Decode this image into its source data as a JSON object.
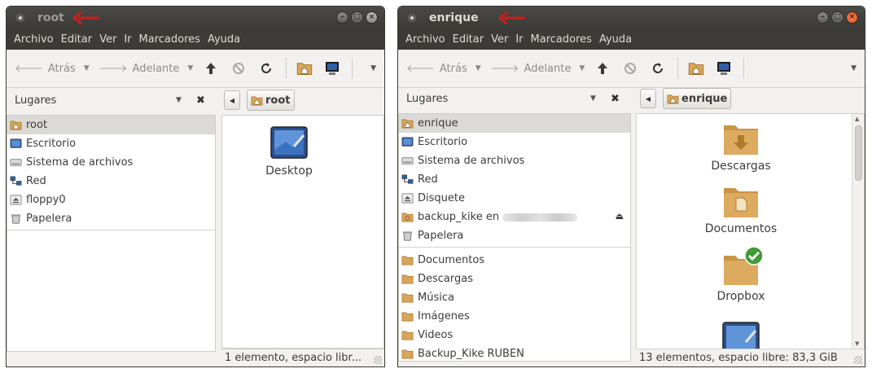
{
  "windows": {
    "root": {
      "title": "root",
      "menu": [
        "Archivo",
        "Editar",
        "Ver",
        "Ir",
        "Marcadores",
        "Ayuda"
      ],
      "toolbar": {
        "back": "Atrás",
        "forward": "Adelante"
      },
      "sidebar_title": "Lugares",
      "places": [
        {
          "label": "root",
          "icon": "home-folder-icon"
        },
        {
          "label": "Escritorio",
          "icon": "desktop-icon"
        },
        {
          "label": "Sistema de archivos",
          "icon": "drive-icon"
        },
        {
          "label": "Red",
          "icon": "network-icon"
        },
        {
          "label": "floppy0",
          "icon": "eject-drive-icon"
        },
        {
          "label": "Papelera",
          "icon": "trash-icon"
        }
      ],
      "path_button": "root",
      "items": [
        {
          "label": "Desktop",
          "icon": "desktop-icon"
        }
      ],
      "status": "1 elemento, espacio libr..."
    },
    "enrique": {
      "title": "enrique",
      "menu": [
        "Archivo",
        "Editar",
        "Ver",
        "Ir",
        "Marcadores",
        "Ayuda"
      ],
      "toolbar": {
        "back": "Atrás",
        "forward": "Adelante"
      },
      "sidebar_title": "Lugares",
      "places": [
        {
          "label": "enrique",
          "icon": "home-folder-icon"
        },
        {
          "label": "Escritorio",
          "icon": "desktop-icon"
        },
        {
          "label": "Sistema de archivos",
          "icon": "drive-icon"
        },
        {
          "label": "Red",
          "icon": "network-icon"
        },
        {
          "label": "Disquete",
          "icon": "eject-drive-icon"
        },
        {
          "label": "backup_kike en",
          "icon": "network-folder-icon"
        },
        {
          "label": "Papelera",
          "icon": "trash-icon"
        }
      ],
      "bookmarks": [
        {
          "label": "Documentos",
          "icon": "folder-icon"
        },
        {
          "label": "Descargas",
          "icon": "folder-icon"
        },
        {
          "label": "Música",
          "icon": "folder-icon"
        },
        {
          "label": "Imágenes",
          "icon": "folder-icon"
        },
        {
          "label": "Videos",
          "icon": "folder-icon"
        },
        {
          "label": "Backup_Kike RUBEN",
          "icon": "folder-icon"
        }
      ],
      "path_button": "enrique",
      "items": [
        {
          "label": "Descargas",
          "icon": "downloads-folder-icon"
        },
        {
          "label": "Documentos",
          "icon": "documents-folder-icon"
        },
        {
          "label": "Dropbox",
          "icon": "dropbox-folder-icon"
        }
      ],
      "status": "13 elementos, espacio libre: 83,3 GiB"
    }
  },
  "colors": {
    "titlebar": "#3c3b37",
    "folder": "#d9a55a",
    "selection": "#dcdad6",
    "annotation_arrow": "#cc1e1e"
  }
}
